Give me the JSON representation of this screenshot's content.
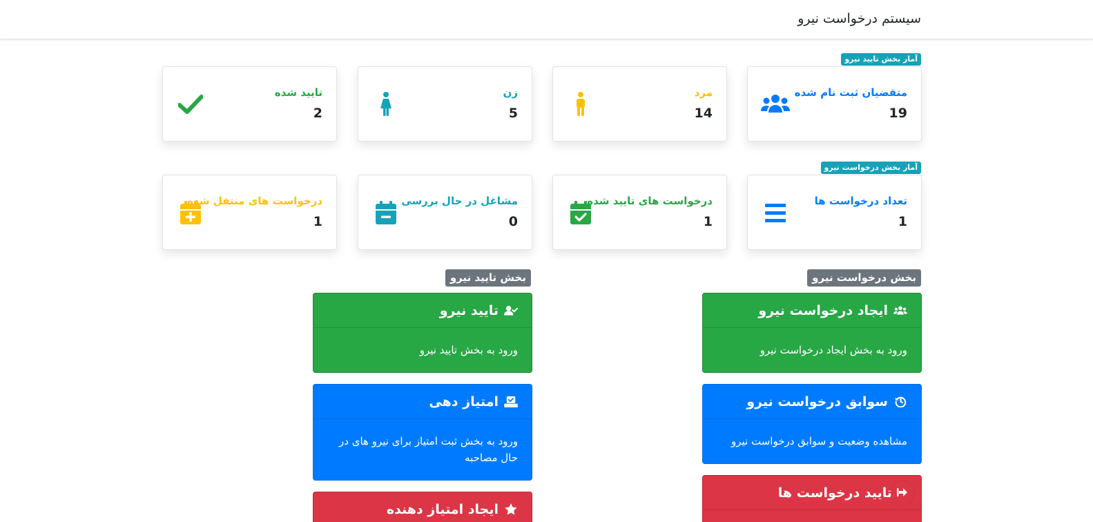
{
  "app": {
    "title": "سیستم درخواست نیرو"
  },
  "sections": {
    "approval_stats_badge": "آمار بخش تایید نیرو",
    "request_stats_badge": "آمار بخش درخواست نیرو"
  },
  "approval_stats": [
    {
      "title": "متقضیان ثبت نام شده",
      "value": "19",
      "icon": "users-icon",
      "color": "#007bff"
    },
    {
      "title": "مرد",
      "value": "14",
      "icon": "male-icon",
      "color": "#ffc107"
    },
    {
      "title": "زن",
      "value": "5",
      "icon": "female-icon",
      "color": "#17a2b8"
    },
    {
      "title": "تایید شده",
      "value": "2",
      "icon": "check-icon",
      "color": "#28a745"
    }
  ],
  "request_stats": [
    {
      "title": "تعداد درخواست ها",
      "value": "1",
      "icon": "list-icon",
      "color": "#007bff"
    },
    {
      "title": "درخواست های تایید شده",
      "value": "1",
      "icon": "calendar-check-icon",
      "color": "#28a745"
    },
    {
      "title": "مشاغل در حال بررسی",
      "value": "0",
      "icon": "calendar-minus-icon",
      "color": "#17a2b8"
    },
    {
      "title": "درخواست های منتقل شده",
      "value": "1",
      "icon": "calendar-plus-icon",
      "color": "#ffc107"
    }
  ],
  "groups": {
    "request_label": "بخش درخواست نیرو",
    "approval_label": "بخش تایید نیرو"
  },
  "request_actions": [
    {
      "title": "ایجاد درخواست نیرو",
      "description": "ورود به بخش ایجاد درخواست نیرو",
      "icon": "users-icon",
      "color": "#28a745"
    },
    {
      "title": "سوابق درخواست نیرو",
      "description": "مشاهده وضعیت و سوابق درخواست نیرو",
      "icon": "history-icon",
      "color": "#007bff"
    },
    {
      "title": "تایید درخواست ها",
      "description": "",
      "icon": "",
      "color": "#dc3545"
    }
  ],
  "approval_actions": [
    {
      "title": "تایید نیرو",
      "description": "ورود به بخش تایید نیرو",
      "icon": "user-check-icon",
      "color": "#28a745"
    },
    {
      "title": "امتیاز دهی",
      "description": "ورود به بخش ثبت امتیاز برای نیرو های در حال مصاحبه",
      "icon": "vote-icon",
      "color": "#007bff"
    },
    {
      "title": "ایجاد امتیاز دهنده",
      "description": "",
      "icon": "star-icon",
      "color": "#dc3545"
    }
  ],
  "floating_button": {
    "icon": "sign-out-icon"
  }
}
